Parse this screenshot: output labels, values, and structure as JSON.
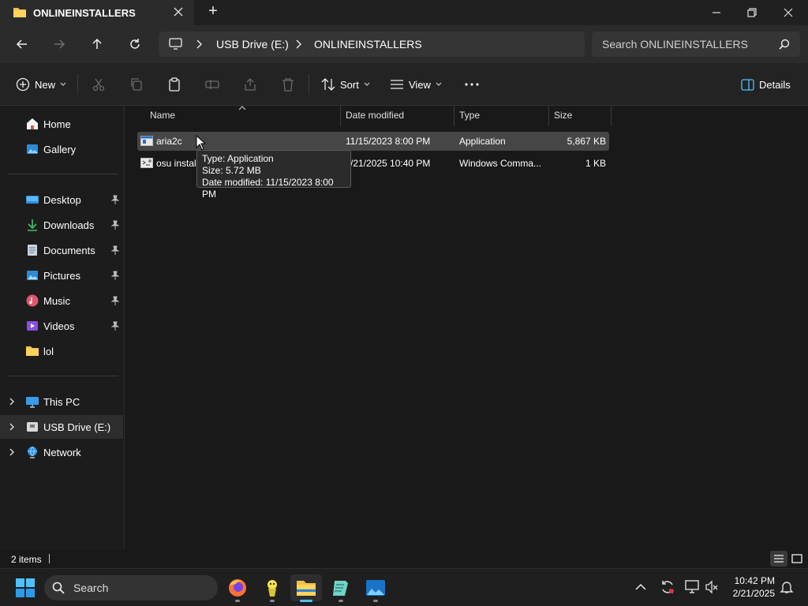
{
  "window": {
    "tab_title": "ONLINEINSTALLERS",
    "new_tab": "+"
  },
  "address": {
    "crumbs": [
      "USB Drive (E:)",
      "ONLINEINSTALLERS"
    ],
    "search_placeholder": "Search ONLINEINSTALLERS"
  },
  "commands": {
    "new": "New",
    "sort": "Sort",
    "view": "View",
    "details": "Details"
  },
  "sidebar": {
    "items": [
      {
        "label": "Home",
        "icon": "home-icon"
      },
      {
        "label": "Gallery",
        "icon": "gallery-icon"
      },
      {
        "label": "Desktop",
        "icon": "desktop-icon"
      },
      {
        "label": "Downloads",
        "icon": "downloads-icon"
      },
      {
        "label": "Documents",
        "icon": "documents-icon"
      },
      {
        "label": "Pictures",
        "icon": "pictures-icon"
      },
      {
        "label": "Music",
        "icon": "music-icon"
      },
      {
        "label": "Videos",
        "icon": "videos-icon"
      },
      {
        "label": "lol",
        "icon": "folder-icon"
      },
      {
        "label": "This PC",
        "icon": "pc-icon"
      },
      {
        "label": "USB Drive (E:)",
        "icon": "usb-drive-icon"
      },
      {
        "label": "Network",
        "icon": "network-icon"
      }
    ]
  },
  "columns": {
    "name": "Name",
    "date": "Date modified",
    "type": "Type",
    "size": "Size"
  },
  "files": [
    {
      "name": "aria2c",
      "date": "11/15/2023 8:00 PM",
      "type": "Application",
      "size": "5,867 KB"
    },
    {
      "name": "osu instal",
      "date": "/21/2025 10:40 PM",
      "type": "Windows Comma...",
      "size": "1 KB"
    }
  ],
  "tooltip": {
    "type": "Type: Application",
    "size": "Size: 5.72 MB",
    "date": "Date modified: 11/15/2023 8:00 PM"
  },
  "status": {
    "count": "2 items"
  },
  "taskbar": {
    "search": "Search",
    "time": "10:42 PM",
    "date": "2/21/2025"
  },
  "colors": {
    "background": "#191919",
    "selected_row": "#464646",
    "accent": "#4cc2ff"
  }
}
